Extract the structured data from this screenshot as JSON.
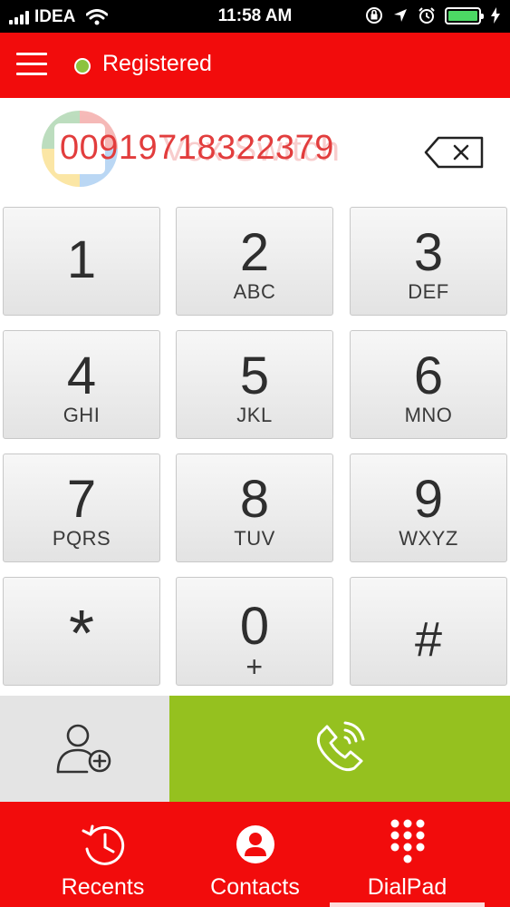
{
  "status_bar": {
    "carrier": "IDEA",
    "time": "11:58 AM",
    "battery_color": "#4cd964"
  },
  "header": {
    "menu_icon": "hamburger-menu-icon",
    "registration_status": "Registered",
    "status_color": "#8dc33f",
    "background_color": "#f20c0c"
  },
  "display": {
    "dialed_number": "00919718322379",
    "watermark_text": "Vox Switch",
    "backspace_icon": "backspace-icon"
  },
  "keypad": {
    "keys": [
      {
        "digit": "1",
        "letters": ""
      },
      {
        "digit": "2",
        "letters": "ABC"
      },
      {
        "digit": "3",
        "letters": "DEF"
      },
      {
        "digit": "4",
        "letters": "GHI"
      },
      {
        "digit": "5",
        "letters": "JKL"
      },
      {
        "digit": "6",
        "letters": "MNO"
      },
      {
        "digit": "7",
        "letters": "PQRS"
      },
      {
        "digit": "8",
        "letters": "TUV"
      },
      {
        "digit": "9",
        "letters": "WXYZ"
      },
      {
        "digit": "*",
        "letters": ""
      },
      {
        "digit": "0",
        "letters": "+"
      },
      {
        "digit": "#",
        "letters": ""
      }
    ]
  },
  "actions": {
    "add_contact_icon": "add-contact-icon",
    "call_icon": "call-icon",
    "call_color": "#95c11f"
  },
  "bottom_nav": {
    "items": [
      {
        "label": "Recents",
        "icon": "recents-clock-icon",
        "active": false
      },
      {
        "label": "Contacts",
        "icon": "contacts-person-icon",
        "active": false
      },
      {
        "label": "DialPad",
        "icon": "dialpad-icon",
        "active": true
      }
    ]
  }
}
